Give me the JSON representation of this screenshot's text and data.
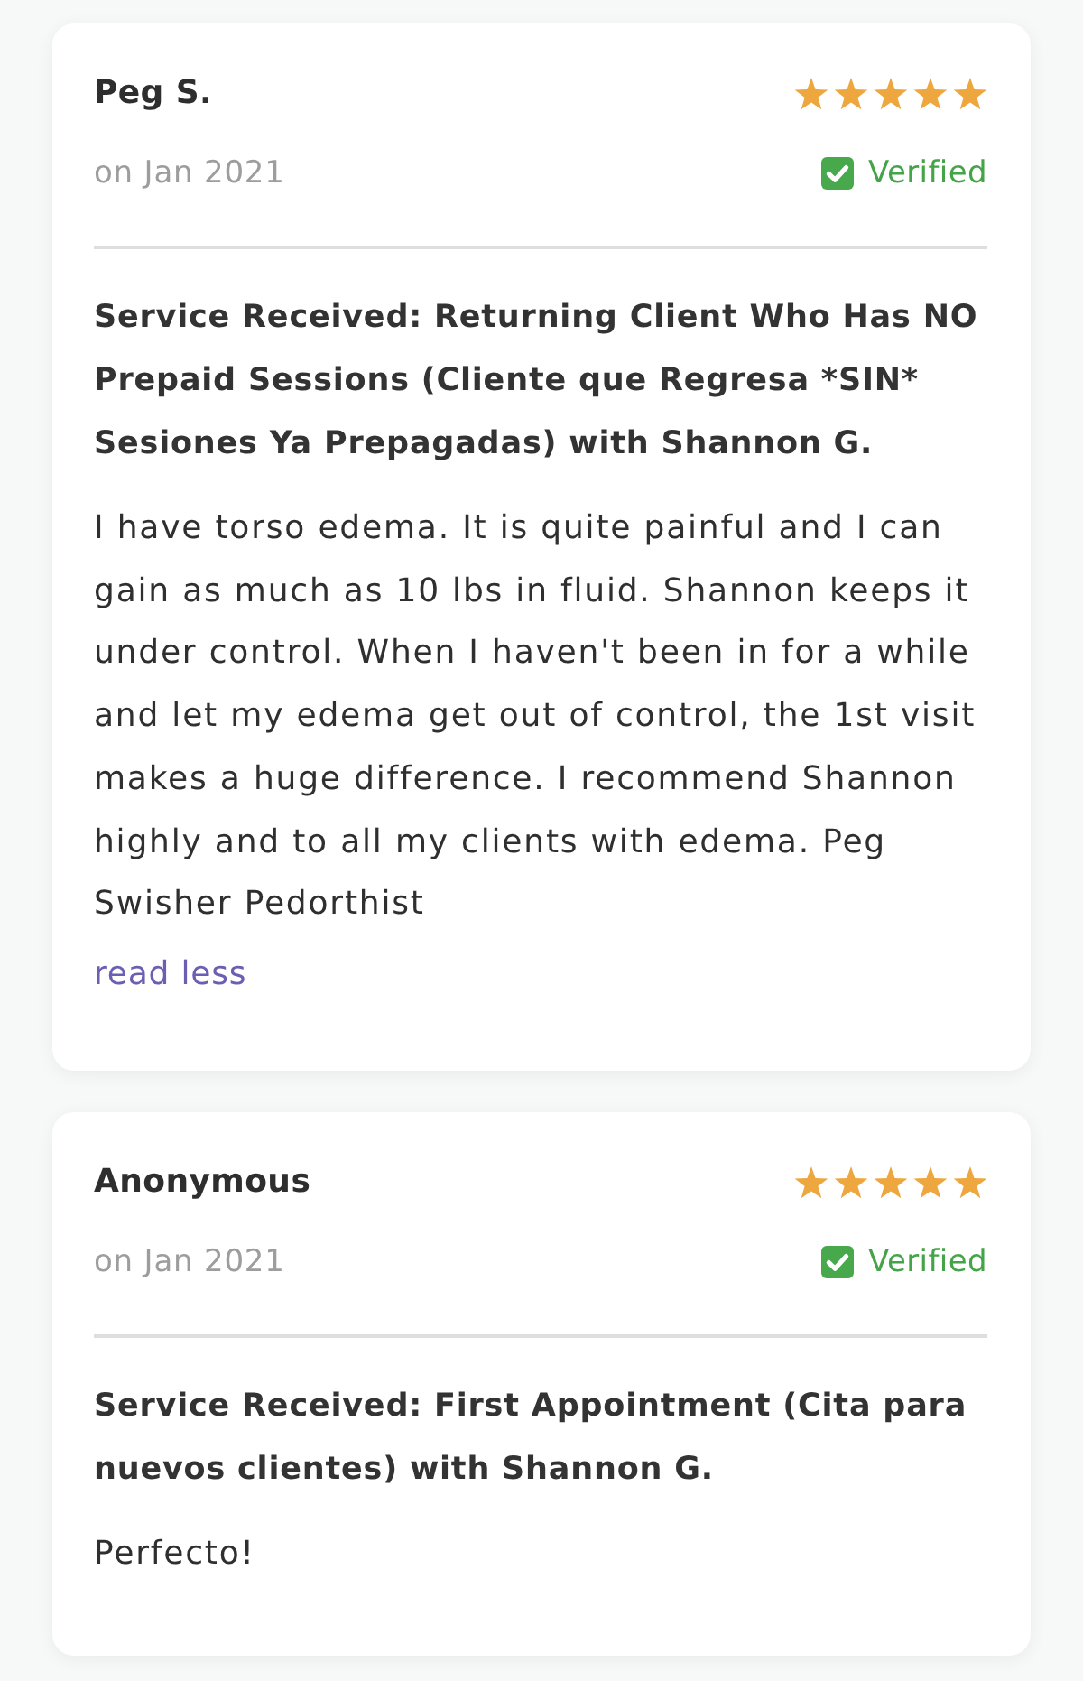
{
  "reviews": [
    {
      "author": "Peg S.",
      "stars": 5,
      "date": "on Jan 2021",
      "badge": "Verified",
      "service": "Service Received: Returning Client Who Has NO Prepaid Sessions (Cliente que Regresa *SIN* Sesiones Ya Prepagadas) with Shannon G.",
      "text": "I have torso edema. It is quite painful and I can gain as much as 10 lbs in fluid. Shannon keeps it under control. When I haven't been in for a while and let my edema get out of control, the 1st visit makes a huge difference. I recommend Shannon highly and to all my clients with edema. Peg Swisher Pedorthist",
      "toggle": "read less"
    },
    {
      "author": "Anonymous",
      "stars": 5,
      "date": "on Jan 2021",
      "badge": "Verified",
      "service": "Service Received: First Appointment (Cita para nuevos clientes) with Shannon G.",
      "text": "Perfecto!"
    }
  ]
}
